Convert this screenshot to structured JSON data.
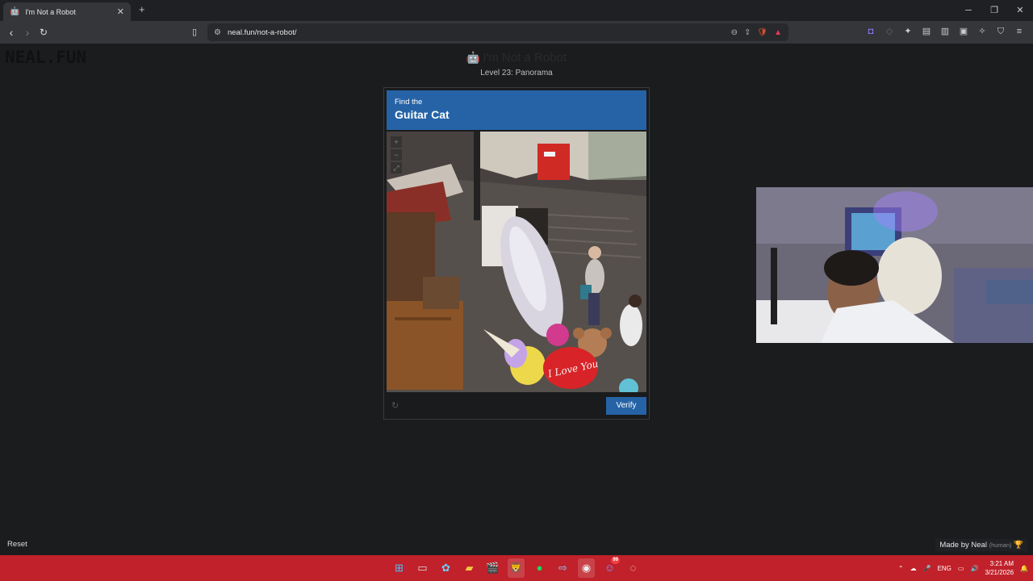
{
  "browser": {
    "tab_title": "I'm Not a Robot",
    "url": "neal.fun/not-a-robot/"
  },
  "page": {
    "logo": "NEAL.FUN",
    "title": "I'm Not a Robot",
    "level": "Level 23: Panorama",
    "reset_label": "Reset",
    "made_by": "Made by Neal",
    "made_by_note": "(human)"
  },
  "captcha": {
    "prompt": "Find the",
    "target": "Guitar Cat",
    "verify_label": "Verify",
    "image_caption": "I Love You"
  },
  "taskbar": {
    "language": "ENG",
    "time": "3:21 AM",
    "date": "3/21/2026",
    "discord_badge": "99"
  },
  "colors": {
    "accent": "#2563a6",
    "taskbar": "#c0212a"
  }
}
